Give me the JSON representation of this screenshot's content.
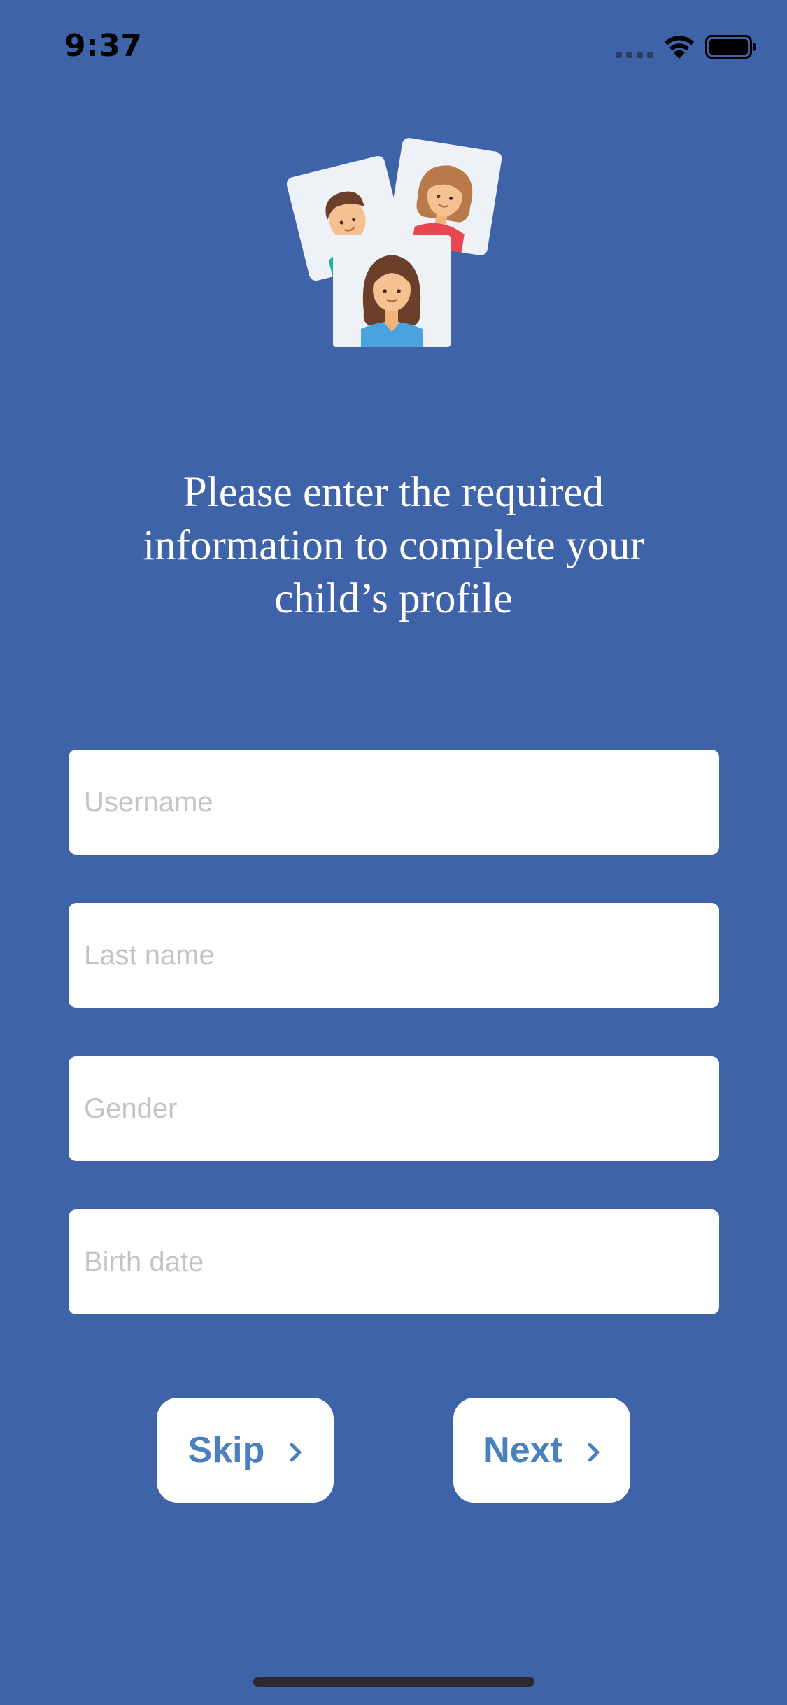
{
  "status_bar": {
    "time": "9:37",
    "signal_icon": "cellular-signal-icon",
    "wifi_icon": "wifi-icon",
    "battery_icon": "battery-icon"
  },
  "illustration": {
    "icon": "children-avatars-illustration"
  },
  "headline": "Please enter the required information to complete your child’s profile",
  "form": {
    "username_placeholder": "Username",
    "username_value": "",
    "lastname_placeholder": "Last name",
    "lastname_value": "",
    "gender_placeholder": "Gender",
    "gender_value": "",
    "birthdate_placeholder": "Birth date",
    "birthdate_value": ""
  },
  "buttons": {
    "skip_label": "Skip",
    "next_label": "Next",
    "chevron_icon": "chevron-right-icon"
  },
  "colors": {
    "background": "#3f63a8",
    "button_text": "#4a80bf",
    "field_background": "#ffffff",
    "placeholder": "#c4c4c6"
  }
}
